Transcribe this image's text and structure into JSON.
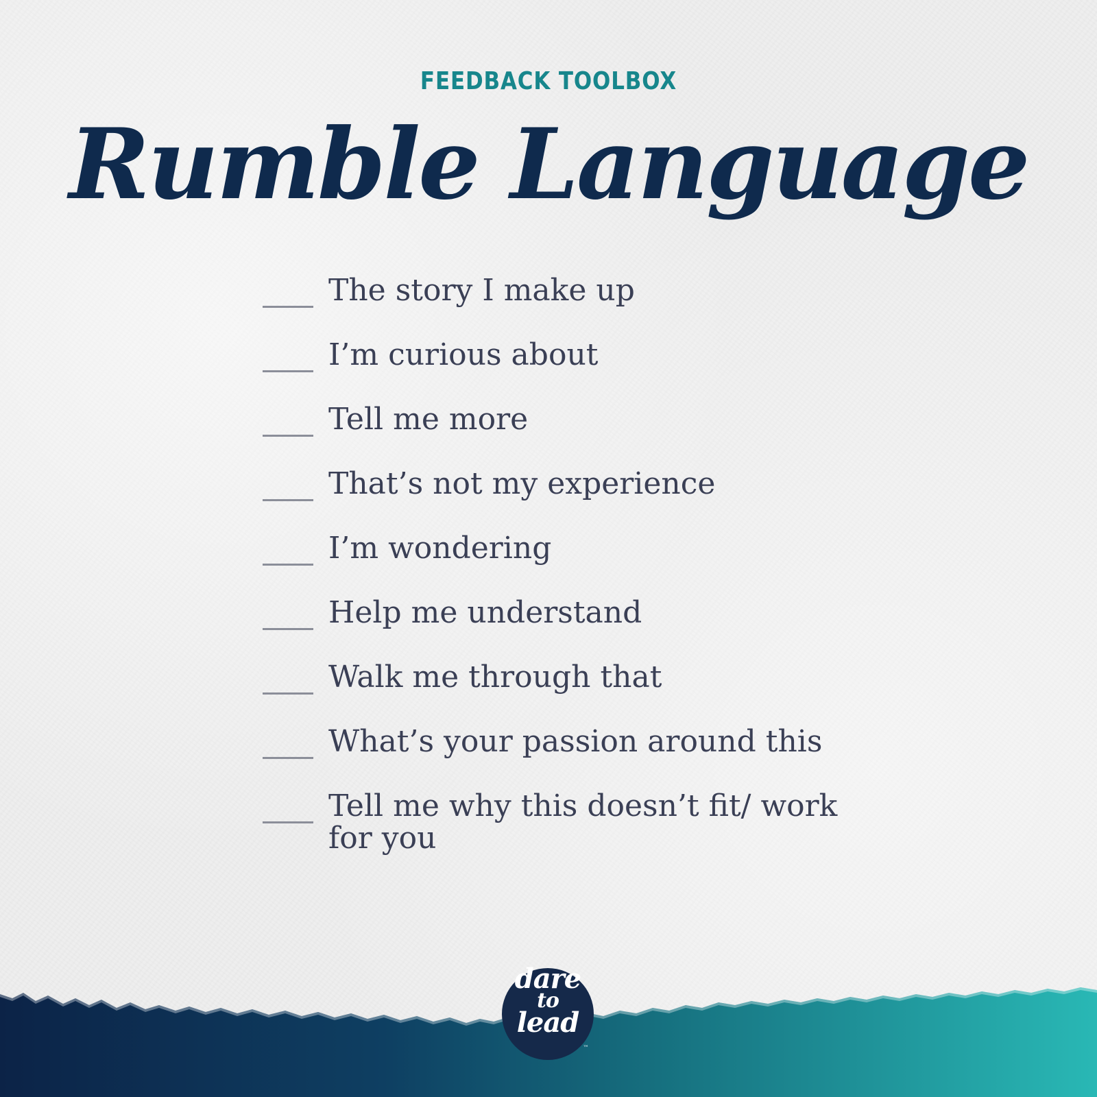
{
  "header": {
    "eyebrow": "FEEDBACK TOOLBOX",
    "title": "Rumble Language"
  },
  "prompts": [
    "The story I make up",
    "I’m curious about",
    "Tell me more",
    "That’s not my experience",
    "I’m wondering",
    "Help me understand",
    "Walk me through that",
    "What’s your passion around this",
    "Tell me why this doesn’t fit/ work for you"
  ],
  "logo": {
    "line1": "dare",
    "line2": "to",
    "line3": "lead",
    "trademark": "™"
  },
  "colors": {
    "eyebrow": "#17868c",
    "title": "#0f2a4d",
    "body_text": "#3a3f55",
    "band_dark": "#0c2347",
    "band_light": "#29b8b5"
  }
}
